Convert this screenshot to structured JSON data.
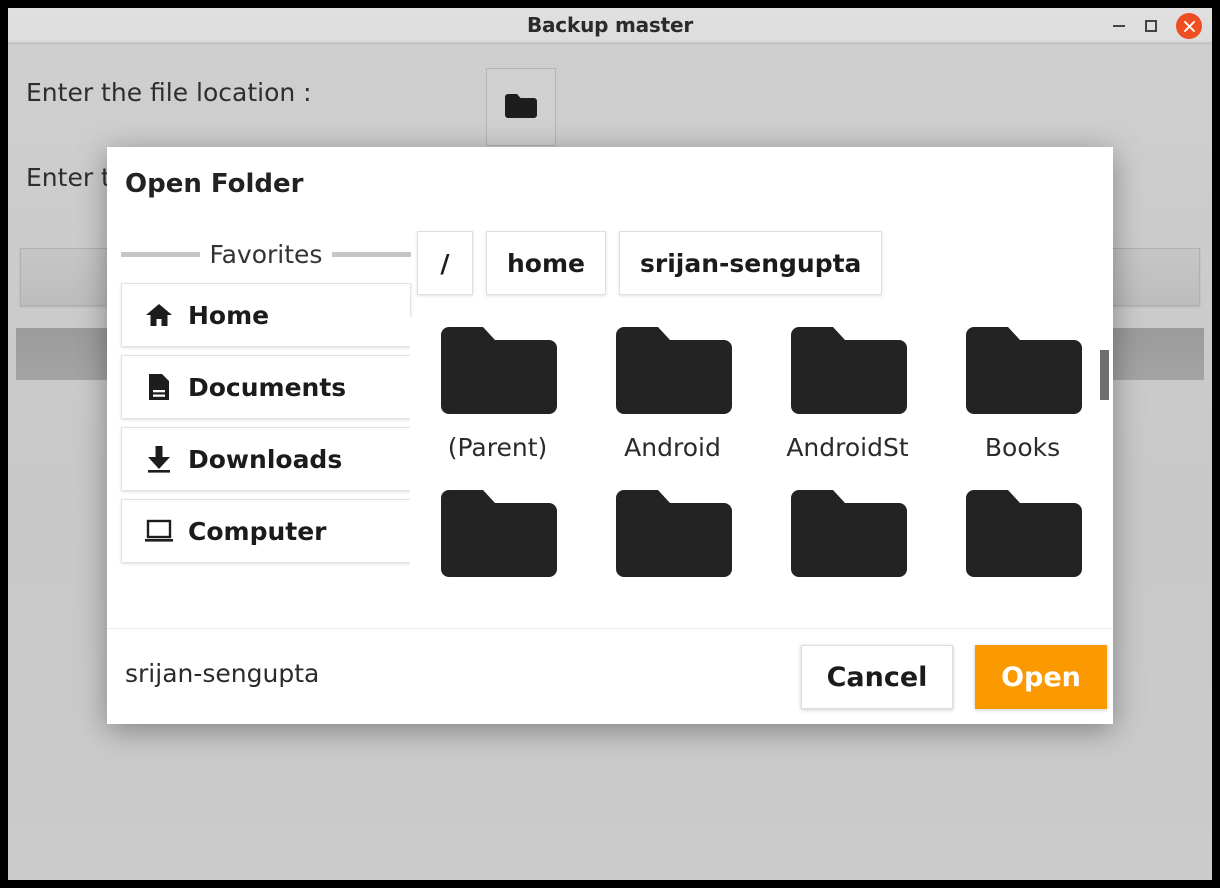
{
  "window": {
    "title": "Backup master",
    "controls": {
      "minimize": {
        "name": "minimize-button",
        "glyph": "minimize-icon"
      },
      "maximize": {
        "name": "maximize-button",
        "glyph": "maximize-icon"
      },
      "close": {
        "name": "close-button",
        "glyph": "close-icon",
        "color": "#ef4e23"
      }
    }
  },
  "app": {
    "file_location_label": "Enter the file location :",
    "output_location_label": "Enter the output file location :",
    "browse_input_icon": "folder-icon",
    "browse_output_icon": "folder-save-icon"
  },
  "dialog": {
    "title": "Open Folder",
    "sidebar": {
      "section_label": "Favorites",
      "items": [
        {
          "label": "Home",
          "icon": "home-icon"
        },
        {
          "label": "Documents",
          "icon": "document-icon"
        },
        {
          "label": "Downloads",
          "icon": "download-icon"
        },
        {
          "label": "Computer",
          "icon": "computer-icon"
        }
      ]
    },
    "breadcrumb": [
      {
        "label": "/"
      },
      {
        "label": "home"
      },
      {
        "label": "srijan-sengupta"
      }
    ],
    "files": [
      {
        "label": "(Parent)",
        "icon": "folder-icon"
      },
      {
        "label": "Android",
        "icon": "folder-icon"
      },
      {
        "label": "AndroidSt",
        "icon": "folder-icon"
      },
      {
        "label": "Books",
        "icon": "folder-icon"
      },
      {
        "label": "",
        "icon": "folder-icon"
      },
      {
        "label": "",
        "icon": "folder-icon"
      },
      {
        "label": "",
        "icon": "folder-icon"
      },
      {
        "label": "",
        "icon": "folder-icon"
      }
    ],
    "footer": {
      "current_path": "srijan-sengupta",
      "cancel_label": "Cancel",
      "open_label": "Open",
      "open_color": "#FB9A00"
    }
  }
}
